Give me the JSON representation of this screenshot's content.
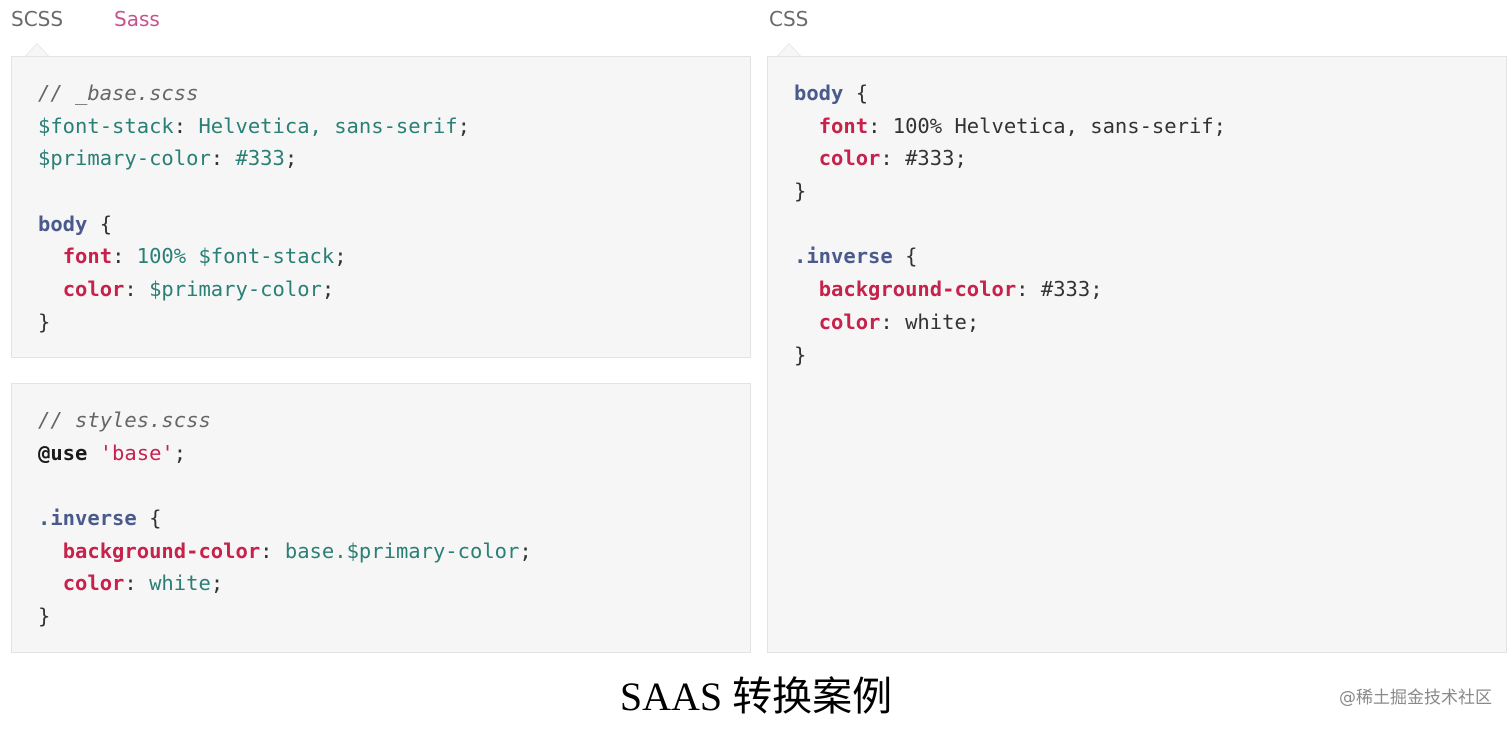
{
  "tabs": {
    "scss": "SCSS",
    "sass": "Sass",
    "css": "CSS"
  },
  "panels": {
    "base_scss": [
      [
        {
          "t": "// _base.scss",
          "c": "comment"
        }
      ],
      [
        {
          "t": "$font-stack",
          "c": "var"
        },
        {
          "t": ": ",
          "c": "punc"
        },
        {
          "t": "Helvetica, sans-serif",
          "c": "val"
        },
        {
          "t": ";",
          "c": "punc"
        }
      ],
      [
        {
          "t": "$primary-color",
          "c": "var"
        },
        {
          "t": ": ",
          "c": "punc"
        },
        {
          "t": "#333",
          "c": "val"
        },
        {
          "t": ";",
          "c": "punc"
        }
      ],
      [],
      [
        {
          "t": "body",
          "c": "sel"
        },
        {
          "t": " {",
          "c": "punc"
        }
      ],
      [
        {
          "t": "  ",
          "c": "plain"
        },
        {
          "t": "font",
          "c": "prop"
        },
        {
          "t": ": ",
          "c": "punc"
        },
        {
          "t": "100% $font-stack",
          "c": "val"
        },
        {
          "t": ";",
          "c": "punc"
        }
      ],
      [
        {
          "t": "  ",
          "c": "plain"
        },
        {
          "t": "color",
          "c": "prop"
        },
        {
          "t": ": ",
          "c": "punc"
        },
        {
          "t": "$primary-color",
          "c": "val"
        },
        {
          "t": ";",
          "c": "punc"
        }
      ],
      [
        {
          "t": "}",
          "c": "punc"
        }
      ]
    ],
    "styles_scss": [
      [
        {
          "t": "// styles.scss",
          "c": "comment"
        }
      ],
      [
        {
          "t": "@use",
          "c": "at"
        },
        {
          "t": " ",
          "c": "plain"
        },
        {
          "t": "'base'",
          "c": "str"
        },
        {
          "t": ";",
          "c": "punc"
        }
      ],
      [],
      [
        {
          "t": ".inverse",
          "c": "sel"
        },
        {
          "t": " {",
          "c": "punc"
        }
      ],
      [
        {
          "t": "  ",
          "c": "plain"
        },
        {
          "t": "background-color",
          "c": "prop"
        },
        {
          "t": ": ",
          "c": "punc"
        },
        {
          "t": "base.$primary-color",
          "c": "val"
        },
        {
          "t": ";",
          "c": "punc"
        }
      ],
      [
        {
          "t": "  ",
          "c": "plain"
        },
        {
          "t": "color",
          "c": "prop"
        },
        {
          "t": ": ",
          "c": "punc"
        },
        {
          "t": "white",
          "c": "val"
        },
        {
          "t": ";",
          "c": "punc"
        }
      ],
      [
        {
          "t": "}",
          "c": "punc"
        }
      ]
    ],
    "css_output": [
      [
        {
          "t": "body",
          "c": "sel"
        },
        {
          "t": " {",
          "c": "punc"
        }
      ],
      [
        {
          "t": "  ",
          "c": "plain"
        },
        {
          "t": "font",
          "c": "prop"
        },
        {
          "t": ": ",
          "c": "punc"
        },
        {
          "t": "100% Helvetica, sans-serif",
          "c": "plain"
        },
        {
          "t": ";",
          "c": "punc"
        }
      ],
      [
        {
          "t": "  ",
          "c": "plain"
        },
        {
          "t": "color",
          "c": "prop"
        },
        {
          "t": ": ",
          "c": "punc"
        },
        {
          "t": "#333",
          "c": "plain"
        },
        {
          "t": ";",
          "c": "punc"
        }
      ],
      [
        {
          "t": "}",
          "c": "punc"
        }
      ],
      [],
      [
        {
          "t": ".inverse",
          "c": "sel"
        },
        {
          "t": " {",
          "c": "punc"
        }
      ],
      [
        {
          "t": "  ",
          "c": "plain"
        },
        {
          "t": "background-color",
          "c": "prop"
        },
        {
          "t": ": ",
          "c": "punc"
        },
        {
          "t": "#333",
          "c": "plain"
        },
        {
          "t": ";",
          "c": "punc"
        }
      ],
      [
        {
          "t": "  ",
          "c": "plain"
        },
        {
          "t": "color",
          "c": "prop"
        },
        {
          "t": ": ",
          "c": "punc"
        },
        {
          "t": "white",
          "c": "plain"
        },
        {
          "t": ";",
          "c": "punc"
        }
      ],
      [
        {
          "t": "}",
          "c": "punc"
        }
      ]
    ]
  },
  "caption": "SAAS 转换案例",
  "watermark": "@稀土掘金技术社区",
  "colors": {
    "tab_active": "#c6538c",
    "tab_inactive": "#6a6a6a",
    "panel_bg": "#f6f6f6",
    "panel_border": "#e3e3e3",
    "variable": "#2a7f76",
    "selector": "#4a5a8c",
    "property": "#c6224c",
    "comment": "#666666"
  }
}
